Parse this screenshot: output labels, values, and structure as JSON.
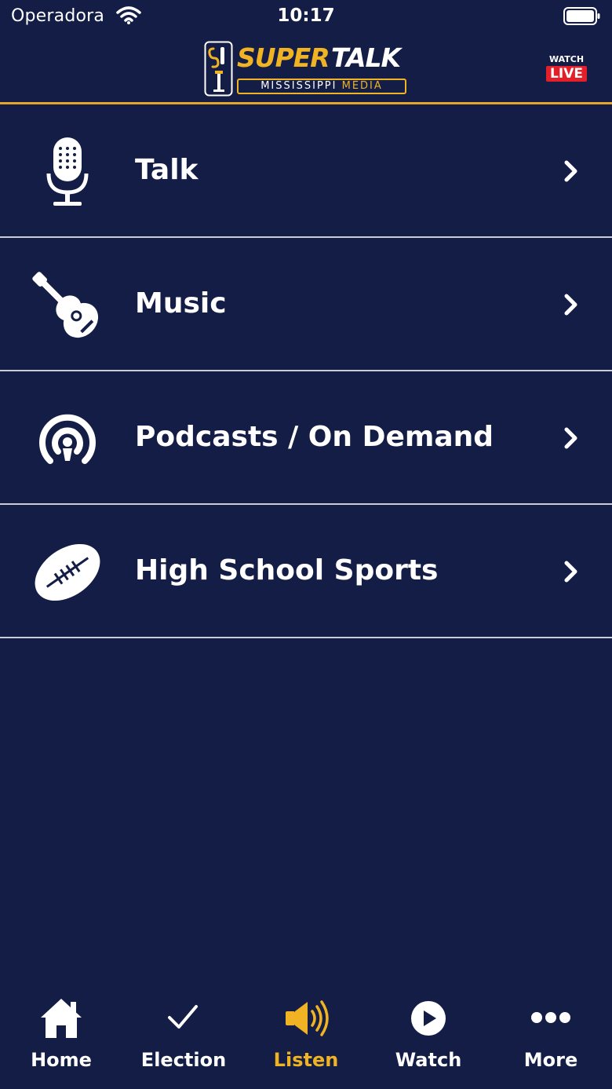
{
  "status_bar": {
    "carrier": "Operadora",
    "time": "10:17"
  },
  "header": {
    "logo": {
      "word1": "SUPER",
      "word2": "TALK",
      "sub_left": "MISSISSIPPI",
      "sub_right": "MEDIA"
    },
    "watch_live": {
      "top": "WATCH",
      "badge": "LIVE"
    }
  },
  "menu": {
    "items": [
      {
        "label": "Talk",
        "icon": "microphone-icon"
      },
      {
        "label": "Music",
        "icon": "guitar-icon"
      },
      {
        "label": "Podcasts / On Demand",
        "icon": "podcast-icon"
      },
      {
        "label": "High School Sports",
        "icon": "football-icon"
      }
    ]
  },
  "tabbar": {
    "tabs": [
      {
        "label": "Home",
        "icon": "home-icon",
        "active": false
      },
      {
        "label": "Election",
        "icon": "checkmark-icon",
        "active": false
      },
      {
        "label": "Listen",
        "icon": "speaker-icon",
        "active": true
      },
      {
        "label": "Watch",
        "icon": "play-icon",
        "active": false
      },
      {
        "label": "More",
        "icon": "more-icon",
        "active": false
      }
    ]
  },
  "colors": {
    "background": "#131d45",
    "accent": "#f0b323",
    "live_red": "#e3202a",
    "divider": "#c9ccd6"
  }
}
